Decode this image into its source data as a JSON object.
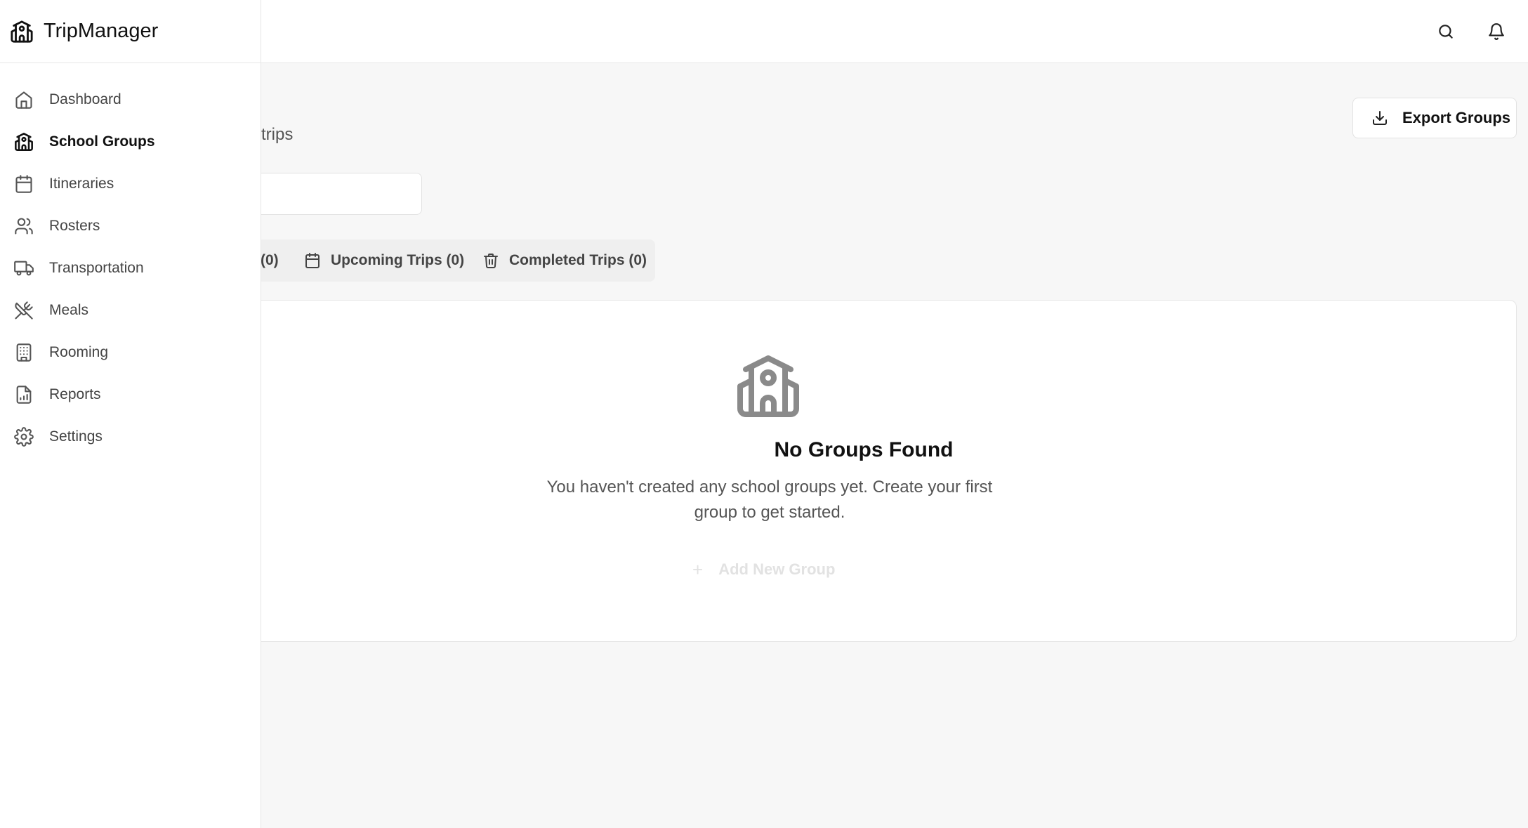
{
  "app": {
    "name": "TripManager"
  },
  "sidebar": {
    "items": [
      {
        "label": "Dashboard",
        "icon": "home-icon",
        "active": false
      },
      {
        "label": "School Groups",
        "icon": "school-icon",
        "active": true
      },
      {
        "label": "Itineraries",
        "icon": "calendar-icon",
        "active": false
      },
      {
        "label": "Rosters",
        "icon": "users-icon",
        "active": false
      },
      {
        "label": "Transportation",
        "icon": "truck-icon",
        "active": false
      },
      {
        "label": "Meals",
        "icon": "utensils-crossed-icon",
        "active": false
      },
      {
        "label": "Rooming",
        "icon": "building-icon",
        "active": false
      },
      {
        "label": "Reports",
        "icon": "file-chart-icon",
        "active": false
      },
      {
        "label": "Settings",
        "icon": "gear-icon",
        "active": false
      }
    ]
  },
  "header": {
    "search_icon": "search-icon",
    "notifications_icon": "bell-icon"
  },
  "page": {
    "subtitle_fragment": "trips",
    "export_label": "Export Groups"
  },
  "tabs": [
    {
      "label": "(0)",
      "icon": ""
    },
    {
      "label": "Upcoming Trips (0)",
      "icon": "calendar-icon"
    },
    {
      "label": "Completed Trips (0)",
      "icon": "trash-icon"
    }
  ],
  "empty_state": {
    "icon": "school-icon",
    "title": "No Groups Found",
    "message": "You haven't created any school groups yet. Create your first group to get started.",
    "add_label": "Add New Group"
  },
  "colors": {
    "accent": "#111111",
    "muted": "#555555",
    "background": "#f7f7f7"
  }
}
